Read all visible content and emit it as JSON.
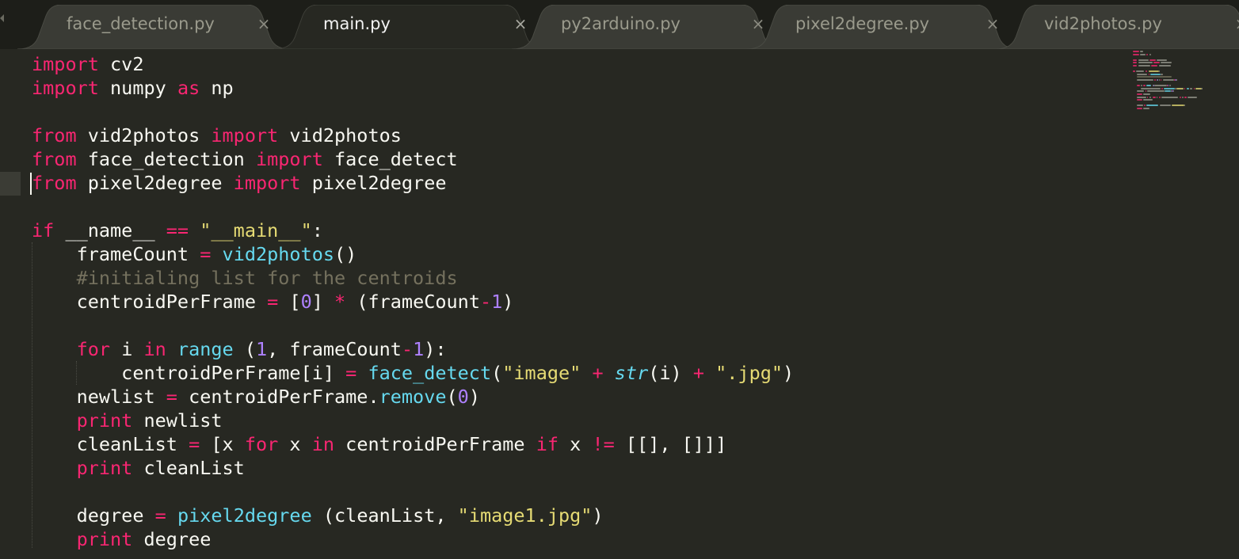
{
  "tabs": [
    {
      "label": "face_detection.py",
      "active": false
    },
    {
      "label": "main.py",
      "active": true
    },
    {
      "label": "py2arduino.py",
      "active": false
    },
    {
      "label": "pixel2degree.py",
      "active": false
    },
    {
      "label": "vid2photos.py",
      "active": false
    }
  ],
  "close_glyph": "×",
  "cursor_line": 5,
  "colors": {
    "background": "#272822",
    "keyword": "#f92672",
    "function": "#66d9ef",
    "string": "#e6db74",
    "number": "#ae81ff",
    "comment": "#75715e",
    "text": "#f8f8f2"
  },
  "code_lines": [
    [
      [
        "kw",
        "import"
      ],
      [
        "t",
        " cv2"
      ]
    ],
    [
      [
        "kw",
        "import"
      ],
      [
        "t",
        " numpy "
      ],
      [
        "kw",
        "as"
      ],
      [
        "t",
        " np"
      ]
    ],
    [],
    [
      [
        "kw",
        "from"
      ],
      [
        "t",
        " vid2photos "
      ],
      [
        "kw",
        "import"
      ],
      [
        "t",
        " vid2photos"
      ]
    ],
    [
      [
        "kw",
        "from"
      ],
      [
        "t",
        " face_detection "
      ],
      [
        "kw",
        "import"
      ],
      [
        "t",
        " face_detect"
      ]
    ],
    [
      [
        "kw",
        "from"
      ],
      [
        "t",
        " pixel2degree "
      ],
      [
        "kw",
        "import"
      ],
      [
        "t",
        " pixel2degree"
      ]
    ],
    [],
    [
      [
        "kw",
        "if"
      ],
      [
        "t",
        " __name__ "
      ],
      [
        "op",
        "=="
      ],
      [
        "t",
        " "
      ],
      [
        "st",
        "\"__main__\""
      ],
      [
        "t",
        ":"
      ]
    ],
    [
      [
        "t",
        "    frameCount "
      ],
      [
        "op",
        "="
      ],
      [
        "t",
        " "
      ],
      [
        "fn",
        "vid2photos"
      ],
      [
        "t",
        "()"
      ]
    ],
    [
      [
        "cm",
        "    #initialing list for the centroids"
      ]
    ],
    [
      [
        "t",
        "    centroidPerFrame "
      ],
      [
        "op",
        "="
      ],
      [
        "t",
        " ["
      ],
      [
        "nm",
        "0"
      ],
      [
        "t",
        "] "
      ],
      [
        "op",
        "*"
      ],
      [
        "t",
        " (frameCount"
      ],
      [
        "op",
        "-"
      ],
      [
        "nm",
        "1"
      ],
      [
        "t",
        ")"
      ]
    ],
    [],
    [
      [
        "t",
        "    "
      ],
      [
        "kw",
        "for"
      ],
      [
        "t",
        " i "
      ],
      [
        "kw",
        "in"
      ],
      [
        "t",
        " "
      ],
      [
        "fn",
        "range"
      ],
      [
        "t",
        " ("
      ],
      [
        "nm",
        "1"
      ],
      [
        "t",
        ", frameCount"
      ],
      [
        "op",
        "-"
      ],
      [
        "nm",
        "1"
      ],
      [
        "t",
        "):"
      ]
    ],
    [
      [
        "t",
        "        centroidPerFrame[i] "
      ],
      [
        "op",
        "="
      ],
      [
        "t",
        " "
      ],
      [
        "fn",
        "face_detect"
      ],
      [
        "t",
        "("
      ],
      [
        "st",
        "\"image\""
      ],
      [
        "t",
        " "
      ],
      [
        "op",
        "+"
      ],
      [
        "t",
        " "
      ],
      [
        "bi",
        "str"
      ],
      [
        "t",
        "(i) "
      ],
      [
        "op",
        "+"
      ],
      [
        "t",
        " "
      ],
      [
        "st",
        "\".jpg\""
      ],
      [
        "t",
        ")"
      ]
    ],
    [
      [
        "t",
        "    newlist "
      ],
      [
        "op",
        "="
      ],
      [
        "t",
        " centroidPerFrame."
      ],
      [
        "fn",
        "remove"
      ],
      [
        "t",
        "("
      ],
      [
        "nm",
        "0"
      ],
      [
        "t",
        ")"
      ]
    ],
    [
      [
        "t",
        "    "
      ],
      [
        "kw",
        "print"
      ],
      [
        "t",
        " newlist"
      ]
    ],
    [
      [
        "t",
        "    cleanList "
      ],
      [
        "op",
        "="
      ],
      [
        "t",
        " [x "
      ],
      [
        "kw",
        "for"
      ],
      [
        "t",
        " x "
      ],
      [
        "kw",
        "in"
      ],
      [
        "t",
        " centroidPerFrame "
      ],
      [
        "kw",
        "if"
      ],
      [
        "t",
        " x "
      ],
      [
        "op",
        "!="
      ],
      [
        "t",
        " [[], []]]"
      ]
    ],
    [
      [
        "t",
        "    "
      ],
      [
        "kw",
        "print"
      ],
      [
        "t",
        " cleanList"
      ]
    ],
    [],
    [
      [
        "t",
        "    degree "
      ],
      [
        "op",
        "="
      ],
      [
        "t",
        " "
      ],
      [
        "fn",
        "pixel2degree"
      ],
      [
        "t",
        " (cleanList, "
      ],
      [
        "st",
        "\"image1.jpg\""
      ],
      [
        "t",
        ")"
      ]
    ],
    [
      [
        "t",
        "    "
      ],
      [
        "kw",
        "print"
      ],
      [
        "t",
        " degree"
      ]
    ]
  ]
}
